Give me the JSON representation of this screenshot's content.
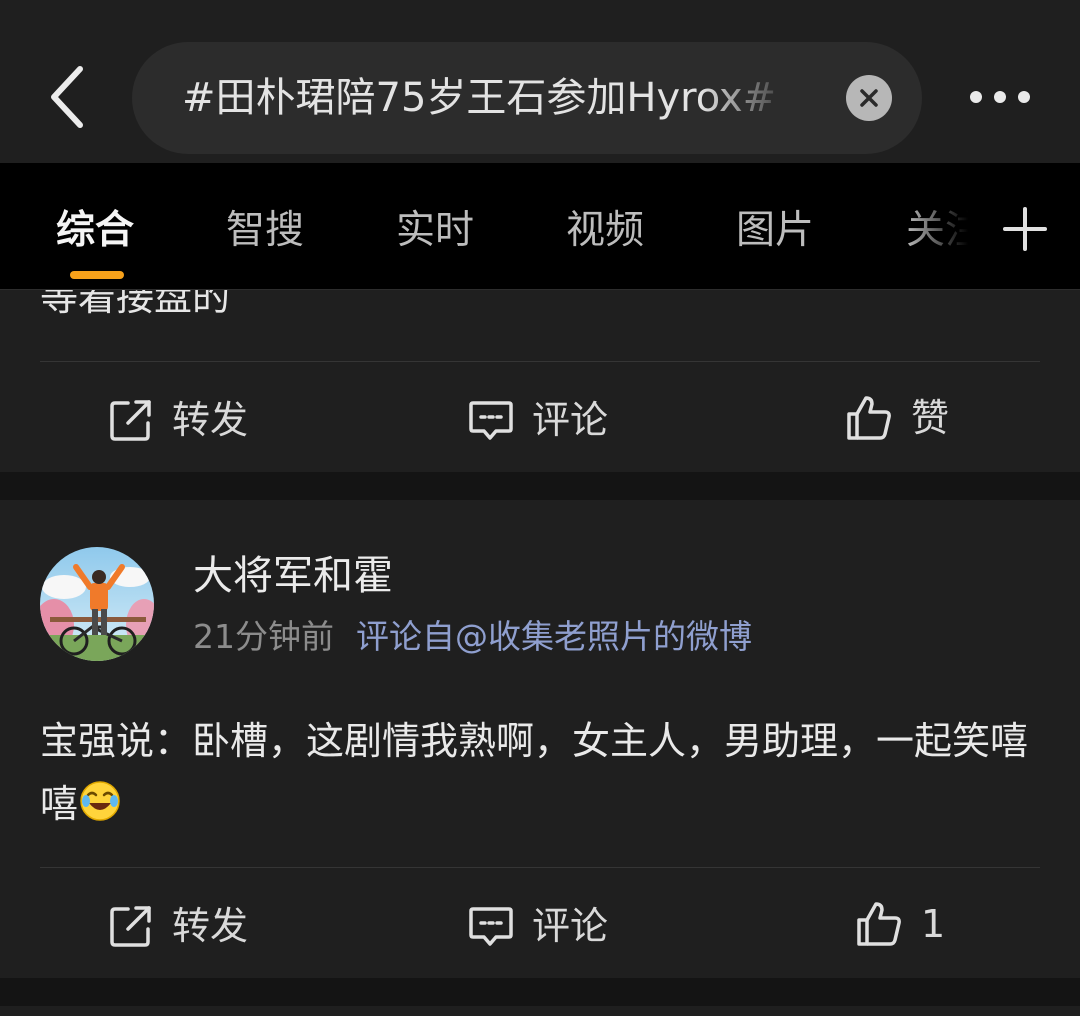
{
  "search": {
    "query": "#田朴珺陪75岁王石参加Hyrox#"
  },
  "tabs": [
    {
      "label": "综合",
      "active": true
    },
    {
      "label": "智搜",
      "active": false
    },
    {
      "label": "实时",
      "active": false
    },
    {
      "label": "视频",
      "active": false
    },
    {
      "label": "图片",
      "active": false
    },
    {
      "label": "关注",
      "active": false
    }
  ],
  "previous_post": {
    "partial_text": "等着接盘的",
    "repost_label": "转发",
    "comment_label": "评论",
    "like_label": "赞"
  },
  "post": {
    "username": "大将军和霍",
    "time": "21分钟前",
    "source": "评论自@收集老照片的微博",
    "text": "宝强说：卧槽，这剧情我熟啊，女主人，男助理，一起笑嘻嘻",
    "emoji": "laugh-cry-emoji",
    "repost_label": "转发",
    "comment_label": "评论",
    "like_count": "1"
  },
  "colors": {
    "background": "#1f1f1f",
    "tab_bar": "#000000",
    "accent": "#f7a11a",
    "link": "#8f9fcf",
    "muted": "#8c8c8c"
  }
}
